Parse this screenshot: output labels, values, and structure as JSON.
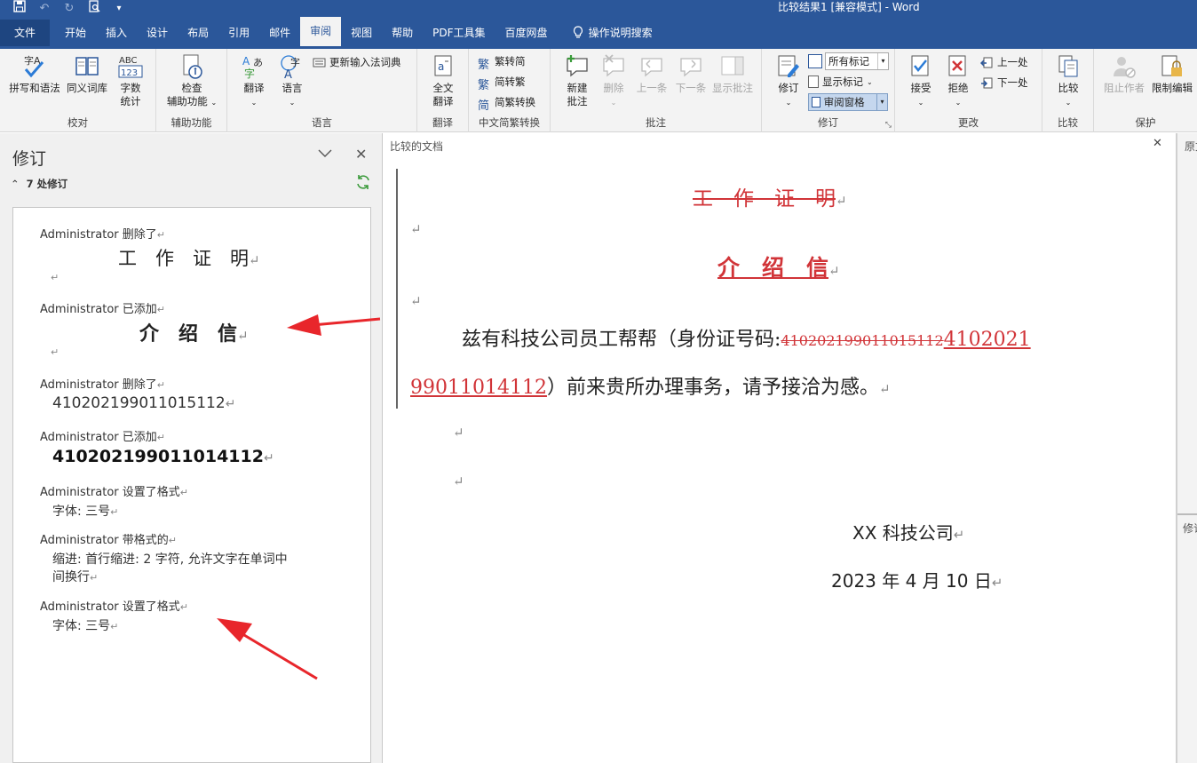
{
  "window": {
    "title": "比较结果1 [兼容模式]  -  Word"
  },
  "qat": {
    "save": "save-icon",
    "undo": "undo-icon",
    "redo": "redo-icon",
    "preview": "print-preview-icon",
    "more": "▾"
  },
  "tabs": {
    "file": "文件",
    "home": "开始",
    "insert": "插入",
    "design": "设计",
    "layout": "布局",
    "references": "引用",
    "mailings": "邮件",
    "review": "审阅",
    "view": "视图",
    "help": "帮助",
    "pdf": "PDF工具集",
    "baidu": "百度网盘",
    "tell": "操作说明搜索"
  },
  "ribbon": {
    "proofing": {
      "label": "校对",
      "spelling": "拼写和语法",
      "thesaurus": "同义词库",
      "wordcount_1": "字数",
      "wordcount_2": "统计"
    },
    "accessibility": {
      "label": "辅助功能",
      "check_1": "检查",
      "check_2": "辅助功能"
    },
    "language": {
      "label": "语言",
      "translate": "翻译",
      "language": "语言",
      "ime": "更新输入法词典"
    },
    "translate": {
      "label": "翻译",
      "full_1": "全文",
      "full_2": "翻译"
    },
    "chinese": {
      "label": "中文简繁转换",
      "t2s": "繁转简",
      "s2t": "简转繁",
      "convert": "简繁转换"
    },
    "comments": {
      "label": "批注",
      "new_1": "新建",
      "new_2": "批注",
      "delete": "删除",
      "prev": "上一条",
      "next": "下一条",
      "show": "显示批注"
    },
    "tracking": {
      "label": "修订",
      "track": "修订",
      "markup": "所有标记",
      "show_markup": "显示标记",
      "pane": "审阅窗格"
    },
    "changes": {
      "label": "更改",
      "accept": "接受",
      "reject": "拒绝",
      "prev": "上一处",
      "next": "下一处"
    },
    "compare": {
      "label": "比较",
      "compare": "比较"
    },
    "protect": {
      "label": "保护",
      "block": "阻止作者",
      "restrict": "限制编辑"
    }
  },
  "revisions_pane": {
    "title": "修订",
    "count": "7 处修订",
    "items": [
      {
        "author": "Administrator",
        "action": "删除了",
        "content": "工　作　证　明"
      },
      {
        "author": "Administrator",
        "action": "已添加",
        "content": "介　绍　信"
      },
      {
        "author": "Administrator",
        "action": "删除了",
        "content": "410202199011015112"
      },
      {
        "author": "Administrator",
        "action": "已添加",
        "content": "410202199011014112"
      },
      {
        "author": "Administrator",
        "action": "设置了格式",
        "content": "字体: 三号"
      },
      {
        "author": "Administrator",
        "action": "带格式的",
        "content": "缩进: 首行缩进:  2 字符, 允许文字在单词中",
        "content2": "间换行"
      },
      {
        "author": "Administrator",
        "action": "设置了格式",
        "content": "字体: 三号"
      }
    ]
  },
  "document": {
    "pane_title": "比较的文档",
    "deleted_title": "工　作　证　明",
    "inserted_title": "介　绍　信",
    "body_prefix": "兹有科技公司员工帮帮（身份证号码:",
    "body_deleted_id": "410202199011015112",
    "body_inserted_id_a": "4102021",
    "body_inserted_id_b": "99011014112",
    "body_suffix": "）前来贵所办理事务，请予接洽为感。",
    "company": "XX 科技公司",
    "date": "2023 年 4 月 10 日"
  },
  "right_pane": {
    "original": "原文",
    "revised": "修订"
  },
  "para_mark": "↵",
  "colors": {
    "accent": "#2b579a",
    "revision": "#d13438",
    "arrow": "#e8262b"
  }
}
